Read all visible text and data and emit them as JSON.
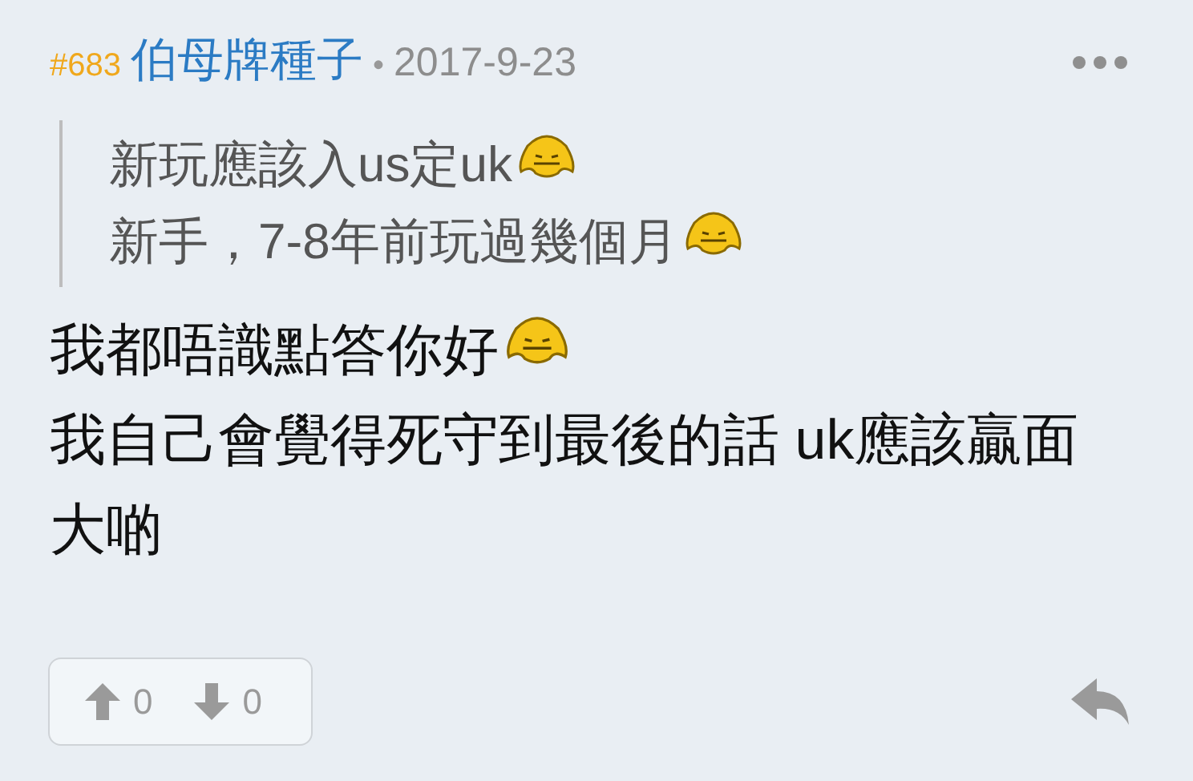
{
  "post": {
    "number": "#683",
    "author": "伯母牌種子",
    "separator": "•",
    "date": "2017-9-23"
  },
  "quote": [
    {
      "text": "新玩應該入us定uk",
      "emoticon": true
    },
    {
      "text": "新手，7-8年前玩過幾個月",
      "emoticon": true
    }
  ],
  "body": [
    {
      "text": "我都唔識點答你好",
      "emoticon": true
    },
    {
      "text": "我自己會覺得死守到最後的話 uk應該贏面大啲",
      "emoticon": false
    }
  ],
  "votes": {
    "up": "0",
    "down": "0"
  }
}
